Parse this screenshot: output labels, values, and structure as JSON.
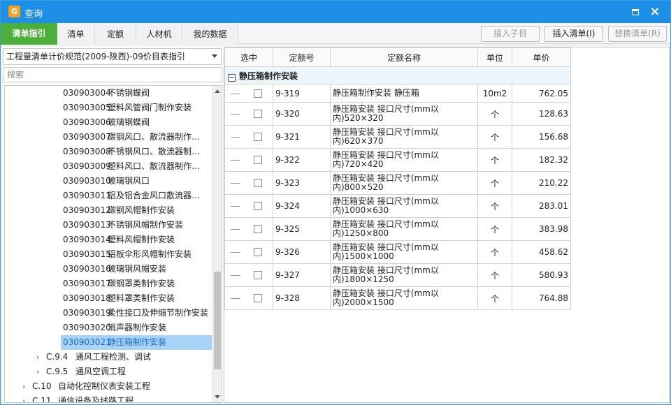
{
  "window": {
    "title": "查询",
    "icon_glyph": "G"
  },
  "tabs": [
    {
      "label": "清单指引",
      "active": true
    },
    {
      "label": "清单",
      "active": false
    },
    {
      "label": "定额",
      "active": false
    },
    {
      "label": "人材机",
      "active": false
    },
    {
      "label": "我的数据",
      "active": false
    }
  ],
  "toolbar": {
    "insert_child": "插入子目",
    "insert_bill": "插入清单(I)",
    "replace_bill": "替换清单(R)"
  },
  "left": {
    "combo_value": "工程量清单计价规范(2009-陕西)-09价目表指引",
    "search_placeholder": "搜索",
    "items": [
      {
        "code": "030903004",
        "name": "不锈钢蝶阀"
      },
      {
        "code": "030903005",
        "name": "塑料风管阀门制作安装"
      },
      {
        "code": "030903006",
        "name": "玻璃钢蝶阀"
      },
      {
        "code": "030903007",
        "name": "碳钢风口、散流器制作…"
      },
      {
        "code": "030903008",
        "name": "不锈钢风口、散流器制…"
      },
      {
        "code": "030903009",
        "name": "塑料风口、散流器制作…"
      },
      {
        "code": "030903010",
        "name": "玻璃钢风口"
      },
      {
        "code": "030903011",
        "name": "铝及铝合金风口散流器…"
      },
      {
        "code": "030903012",
        "name": "碳钢风帽制作安装"
      },
      {
        "code": "030903013",
        "name": "不锈钢风帽制作安装"
      },
      {
        "code": "030903014",
        "name": "塑料风帽制作安装"
      },
      {
        "code": "030903015",
        "name": "铝板伞形风帽制作安装"
      },
      {
        "code": "030903016",
        "name": "玻璃钢风帽安装"
      },
      {
        "code": "030903017",
        "name": "碳钢罩类制作安装"
      },
      {
        "code": "030903018",
        "name": "塑料罩类制作安装"
      },
      {
        "code": "030903019",
        "name": "柔性接口及伸缩节制作安装"
      },
      {
        "code": "030903020",
        "name": "消声器制作安装"
      },
      {
        "code": "030903021",
        "name": "静压箱制作安装"
      }
    ],
    "nodes": [
      {
        "code": "C.9.4",
        "name": "通风工程检测、调试"
      },
      {
        "code": "C.9.5",
        "name": "通风空调工程"
      },
      {
        "code": "C.10",
        "name": "自动化控制仪表安装工程"
      },
      {
        "code": "C.11",
        "name": "通信设备及线路工程"
      }
    ]
  },
  "grid": {
    "headers": [
      "选中",
      "定额号",
      "定额名称",
      "单位",
      "单价"
    ],
    "group_title": "静压箱制作安装",
    "rows": [
      {
        "code": "9-319",
        "name1": "静压箱制作安装 静压箱",
        "name2": "",
        "unit": "10m2",
        "price": "762.05"
      },
      {
        "code": "9-320",
        "name1": "静压箱安装 接口尺寸(mm以",
        "name2": "内)520×320",
        "unit": "个",
        "price": "128.63"
      },
      {
        "code": "9-321",
        "name1": "静压箱安装 接口尺寸(mm以",
        "name2": "内)620×370",
        "unit": "个",
        "price": "156.68"
      },
      {
        "code": "9-322",
        "name1": "静压箱安装 接口尺寸(mm以",
        "name2": "内)720×420",
        "unit": "个",
        "price": "182.32"
      },
      {
        "code": "9-323",
        "name1": "静压箱安装 接口尺寸(mm以",
        "name2": "内)800×520",
        "unit": "个",
        "price": "210.22"
      },
      {
        "code": "9-324",
        "name1": "静压箱安装 接口尺寸(mm以",
        "name2": "内)1000×630",
        "unit": "个",
        "price": "283.01"
      },
      {
        "code": "9-325",
        "name1": "静压箱安装 接口尺寸(mm以",
        "name2": "内)1250×800",
        "unit": "个",
        "price": "383.98"
      },
      {
        "code": "9-326",
        "name1": "静压箱安装 接口尺寸(mm以",
        "name2": "内)1500×1000",
        "unit": "个",
        "price": "458.62"
      },
      {
        "code": "9-327",
        "name1": "静压箱安装 接口尺寸(mm以",
        "name2": "内)1800×1250",
        "unit": "个",
        "price": "580.93"
      },
      {
        "code": "9-328",
        "name1": "静压箱安装 接口尺寸(mm以",
        "name2": "内)2000×1500",
        "unit": "个",
        "price": "764.88"
      }
    ]
  },
  "colors": {
    "titlebar": "#1e8fe6",
    "active_tab": "#4caf3a",
    "selection": "#a8d3f7",
    "selection_text": "#1a6ac9"
  }
}
